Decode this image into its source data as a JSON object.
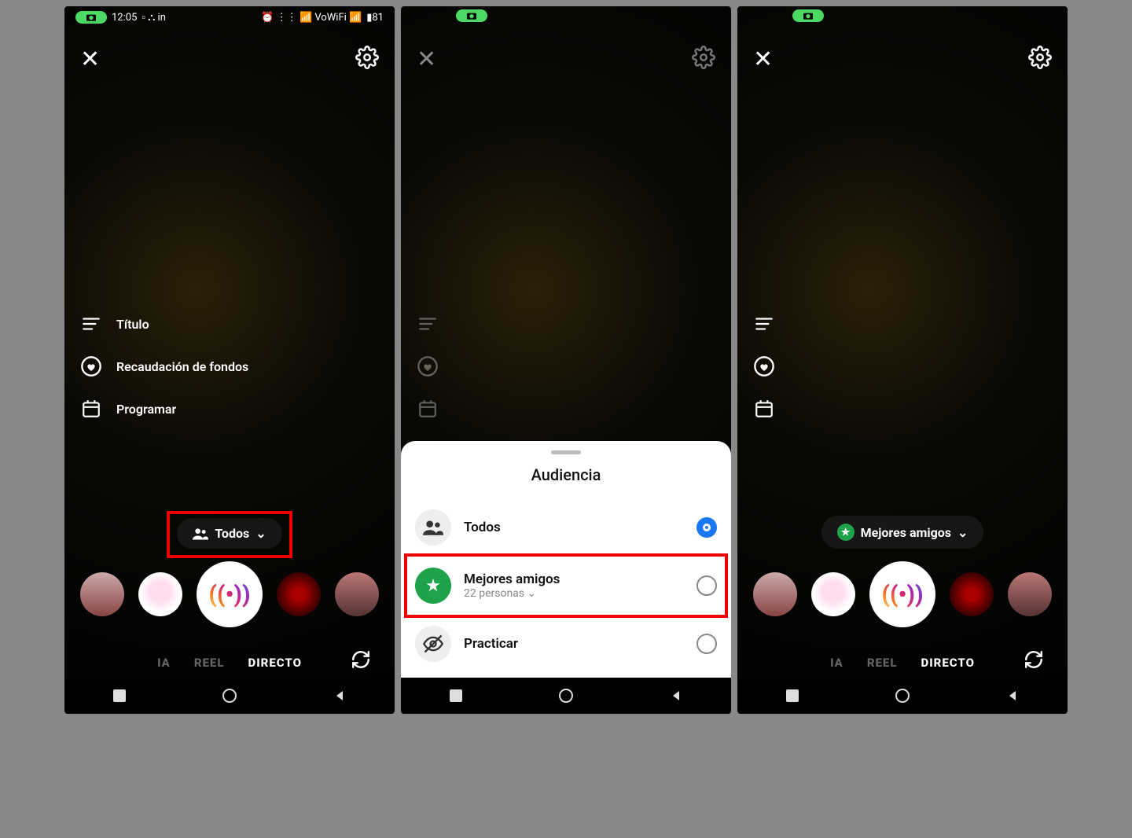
{
  "status": {
    "time": "12:05",
    "battery": "81"
  },
  "options": {
    "title": "Título",
    "fundraiser": "Recaudación de fondos",
    "schedule": "Programar"
  },
  "audience_pill": {
    "todos": "Todos",
    "best": "Mejores amigos"
  },
  "camera_tabs": {
    "historia_suffix": "IA",
    "reel": "REEL",
    "directo": "DIRECTO"
  },
  "sheet": {
    "title": "Audiencia",
    "todos": "Todos",
    "best_label": "Mejores amigos",
    "best_sub": "22 personas",
    "practice": "Practicar"
  }
}
